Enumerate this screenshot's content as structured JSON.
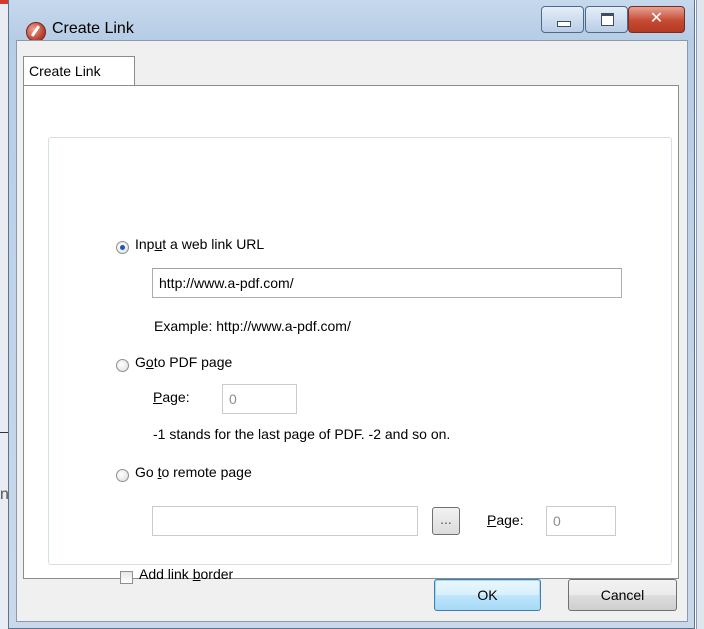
{
  "window": {
    "title": "Create Link",
    "icon": "app-icon",
    "controls": [
      "minimize-icon",
      "maximize-icon",
      "close-icon"
    ]
  },
  "background": {
    "fragment_text": "n"
  },
  "tabs": [
    {
      "label": "Create Link",
      "selected": true
    }
  ],
  "options": {
    "web_url": {
      "label_pre": "Inp",
      "label_mnemonic": "u",
      "label_post": "t a web link URL",
      "selected": true,
      "value": "http://www.a-pdf.com/",
      "example": "Example: http://www.a-pdf.com/"
    },
    "goto_pdf": {
      "label_pre": "G",
      "label_mnemonic": "o",
      "label_post": "to PDF page",
      "selected": false,
      "page_label_mnemonic": "P",
      "page_label_post": "age:",
      "page_value": "0",
      "hint": "-1 stands for the last page of PDF. -2 and so on."
    },
    "remote": {
      "label_pre": "Go ",
      "label_mnemonic": "t",
      "label_post": "o remote page",
      "selected": false,
      "path_value": "",
      "browse_label": "...",
      "page_label_mnemonic": "P",
      "page_label_post": "age:",
      "page_value": "0"
    }
  },
  "border_option": {
    "label_pre": "Add link ",
    "label_mnemonic": "b",
    "label_post": "order",
    "checked": false
  },
  "buttons": {
    "ok": "OK",
    "cancel": "Cancel"
  }
}
